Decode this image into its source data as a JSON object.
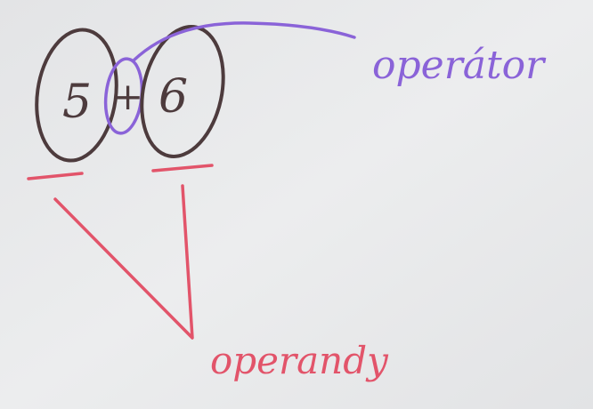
{
  "photo": {
    "background_color": "#e8e9eb",
    "marker_colors": {
      "black": "#4a3a3c",
      "purple": "#8a63d8",
      "red": "#e2546a"
    }
  },
  "expression": {
    "left_operand": "5",
    "operator": "+",
    "right_operand": "6"
  },
  "labels": {
    "operator": "operátor",
    "operands": "operandy"
  }
}
